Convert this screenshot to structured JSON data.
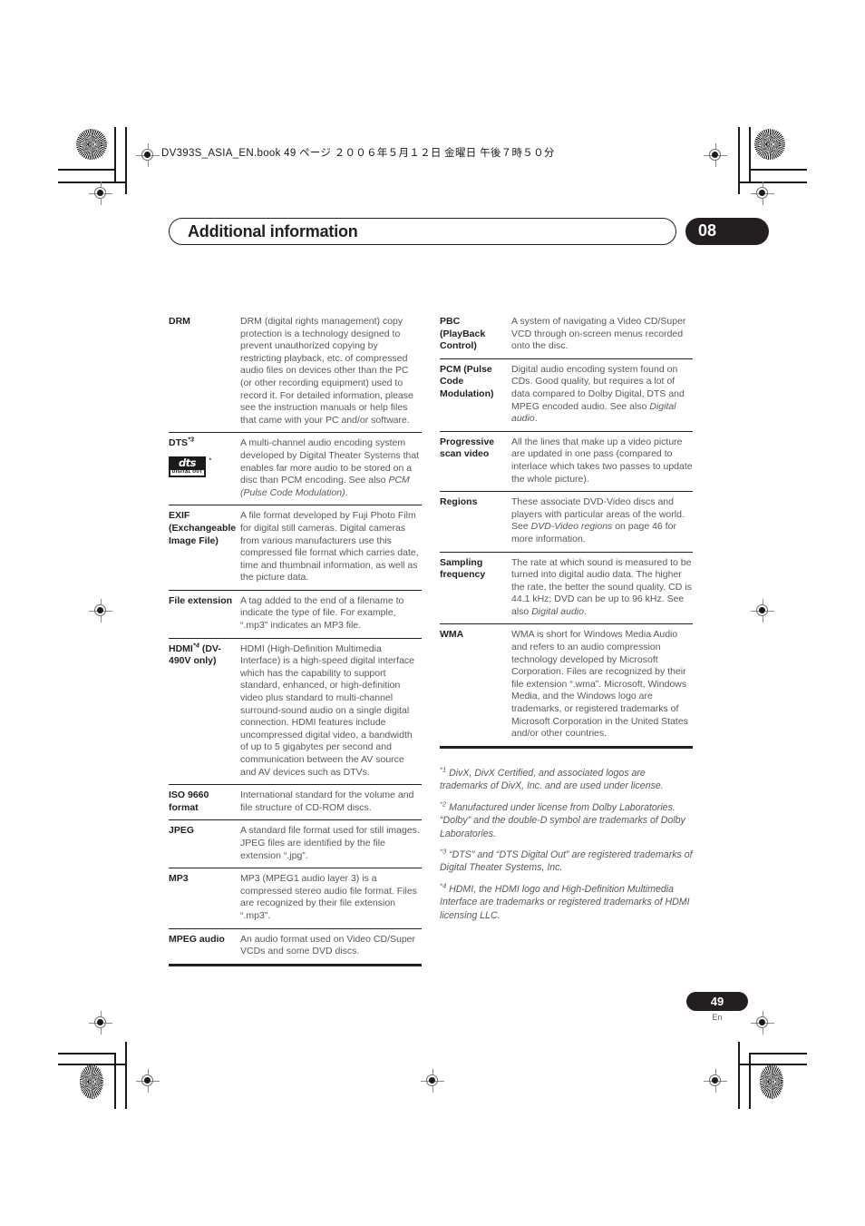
{
  "print_header": {
    "file_line": "DV393S_ASIA_EN.book   49 ページ   ２００６年５月１２日   金曜日   午後７時５０分"
  },
  "chapter": {
    "title": "Additional information",
    "number": "08"
  },
  "glossary": {
    "left_column": [
      {
        "term": "DRM",
        "sup": "",
        "definition": "DRM (digital rights management) copy protection is a technology designed to prevent unauthorized copying by restricting playback, etc. of compressed audio files on devices other than the PC (or other recording equipment) used to record it. For detailed information, please see the instruction manuals or help files that came with your PC and/or software."
      },
      {
        "term": "DTS",
        "sup": "*3",
        "definition_a": "A multi-channel audio encoding system developed by Digital Theater Systems that enables far more audio to be stored on a disc than PCM encoding. See also ",
        "definition_italic": "PCM (Pulse Code Modulation)",
        "definition_b": ".",
        "logo": {
          "name": "dts-digital-out-logo",
          "word": "dts",
          "sub": "DIGITAL OUT",
          "mark": "*"
        }
      },
      {
        "term": "EXIF (Exchangeable Image File)",
        "sup": "",
        "definition": "A file format developed by Fuji Photo Film for digital still cameras. Digital cameras from various manufacturers use this compressed file format which carries date, time and thumbnail information, as well as the picture data."
      },
      {
        "term": "File extension",
        "sup": "",
        "definition": "A tag added to the end of a filename to indicate the type of file. For example, “.mp3” indicates an MP3 file."
      },
      {
        "term": "HDMI",
        "sup": "*4",
        "term_tail": " (DV-490V only)",
        "definition": "HDMI (High-Definition Multimedia Interface) is a high-speed digital interface which has the capability to support standard, enhanced, or high-definition video plus standard to multi-channel surround-sound audio on a single digital connection. HDMI features include uncompressed digital video, a bandwidth of up to 5 gigabytes per second and communication between the AV source and AV devices such as DTVs."
      },
      {
        "term": "ISO 9660 format",
        "sup": "",
        "definition": "International standard for the volume and file structure of CD-ROM discs."
      },
      {
        "term": "JPEG",
        "sup": "",
        "definition": "A standard file format used for still images. JPEG files are identified by the file extension “.jpg”."
      },
      {
        "term": "MP3",
        "sup": "",
        "definition": "MP3 (MPEG1 audio layer 3) is a compressed stereo audio file format. Files are recognized by their file extension “.mp3”."
      },
      {
        "term": "MPEG audio",
        "sup": "",
        "definition": "An audio format used on Video CD/Super VCDs and some DVD discs."
      }
    ],
    "right_column": [
      {
        "term": "PBC (PlayBack Control)",
        "definition": "A system of navigating a Video CD/Super VCD through on-screen menus recorded onto the disc."
      },
      {
        "term": "PCM (Pulse Code Modulation)",
        "definition_a": "Digital audio encoding system found on CDs. Good quality, but requires a lot of data compared to Dolby Digital, DTS and MPEG encoded audio. See also ",
        "definition_italic": "Digital audio",
        "definition_b": "."
      },
      {
        "term": "Progressive scan video",
        "definition": "All the lines that make up a video picture are updated in one pass (compared to interlace which takes two passes to update the whole picture)."
      },
      {
        "term": "Regions",
        "definition_a": "These associate DVD-Video discs and players with particular areas of the world. See ",
        "definition_italic": "DVD-Video regions",
        "definition_b": " on page 46 for more information."
      },
      {
        "term": "Sampling frequency",
        "definition_a": "The rate at which sound is measured to be turned into digital audio data. The higher the rate, the better the sound quality. CD is 44.1 kHz; DVD can be up to 96 kHz. See also ",
        "definition_italic": "Digital audio",
        "definition_b": "."
      },
      {
        "term": "WMA",
        "definition": "WMA is short for Windows Media Audio and refers to an audio compression technology developed by Microsoft Corporation. Files are recognized by their file extension “.wma”. Microsoft, Windows Media, and the Windows logo are trademarks, or registered trademarks of Microsoft Corporation in the United States and/or other countries."
      }
    ]
  },
  "footnotes": [
    {
      "marker": "*1",
      "text": " DivX, DivX Certified, and associated logos are trademarks of DivX, Inc. and are used under license."
    },
    {
      "marker": "*2",
      "text": " Manufactured under license from Dolby Laboratories. “Dolby” and the double-D symbol are trademarks of Dolby Laboratories."
    },
    {
      "marker": "*3",
      "text": " “DTS” and “DTS Digital Out” are registered trademarks of Digital Theater Systems, Inc."
    },
    {
      "marker": "*4",
      "text": " HDMI, the HDMI logo and High-Definition Multimedia Interface are trademarks or registered trademarks of HDMI licensing LLC."
    }
  ],
  "page_footer": {
    "number": "49",
    "language": "En"
  },
  "colors": {
    "ink": "#231f20",
    "body_text": "#58585b",
    "paper": "#ffffff"
  }
}
